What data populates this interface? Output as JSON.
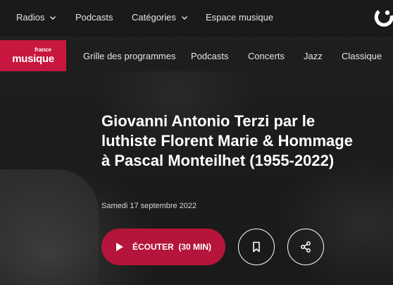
{
  "topnav": {
    "radios_label": "Radios",
    "podcasts_label": "Podcasts",
    "categories_label": "Catégories",
    "espace_label": "Espace musique"
  },
  "brand": {
    "logo_small": "france",
    "logo_big": "musique",
    "color": "#c8173f"
  },
  "subnav": {
    "items": [
      "Grille des programmes",
      "Podcasts",
      "Concerts",
      "Jazz",
      "Classique"
    ]
  },
  "episode": {
    "title": "Giovanni Antonio Terzi par le luthiste Florent Marie & Hommage à Pascal Monteilhet (1955-2022)",
    "date": "Samedi 17 septembre 2022",
    "listen_label": "ÉCOUTER",
    "duration_label": "(30 MIN)"
  },
  "icons": {
    "play": "play-icon",
    "bookmark": "bookmark-icon",
    "share": "share-icon",
    "chevron": "chevron-down-icon"
  }
}
